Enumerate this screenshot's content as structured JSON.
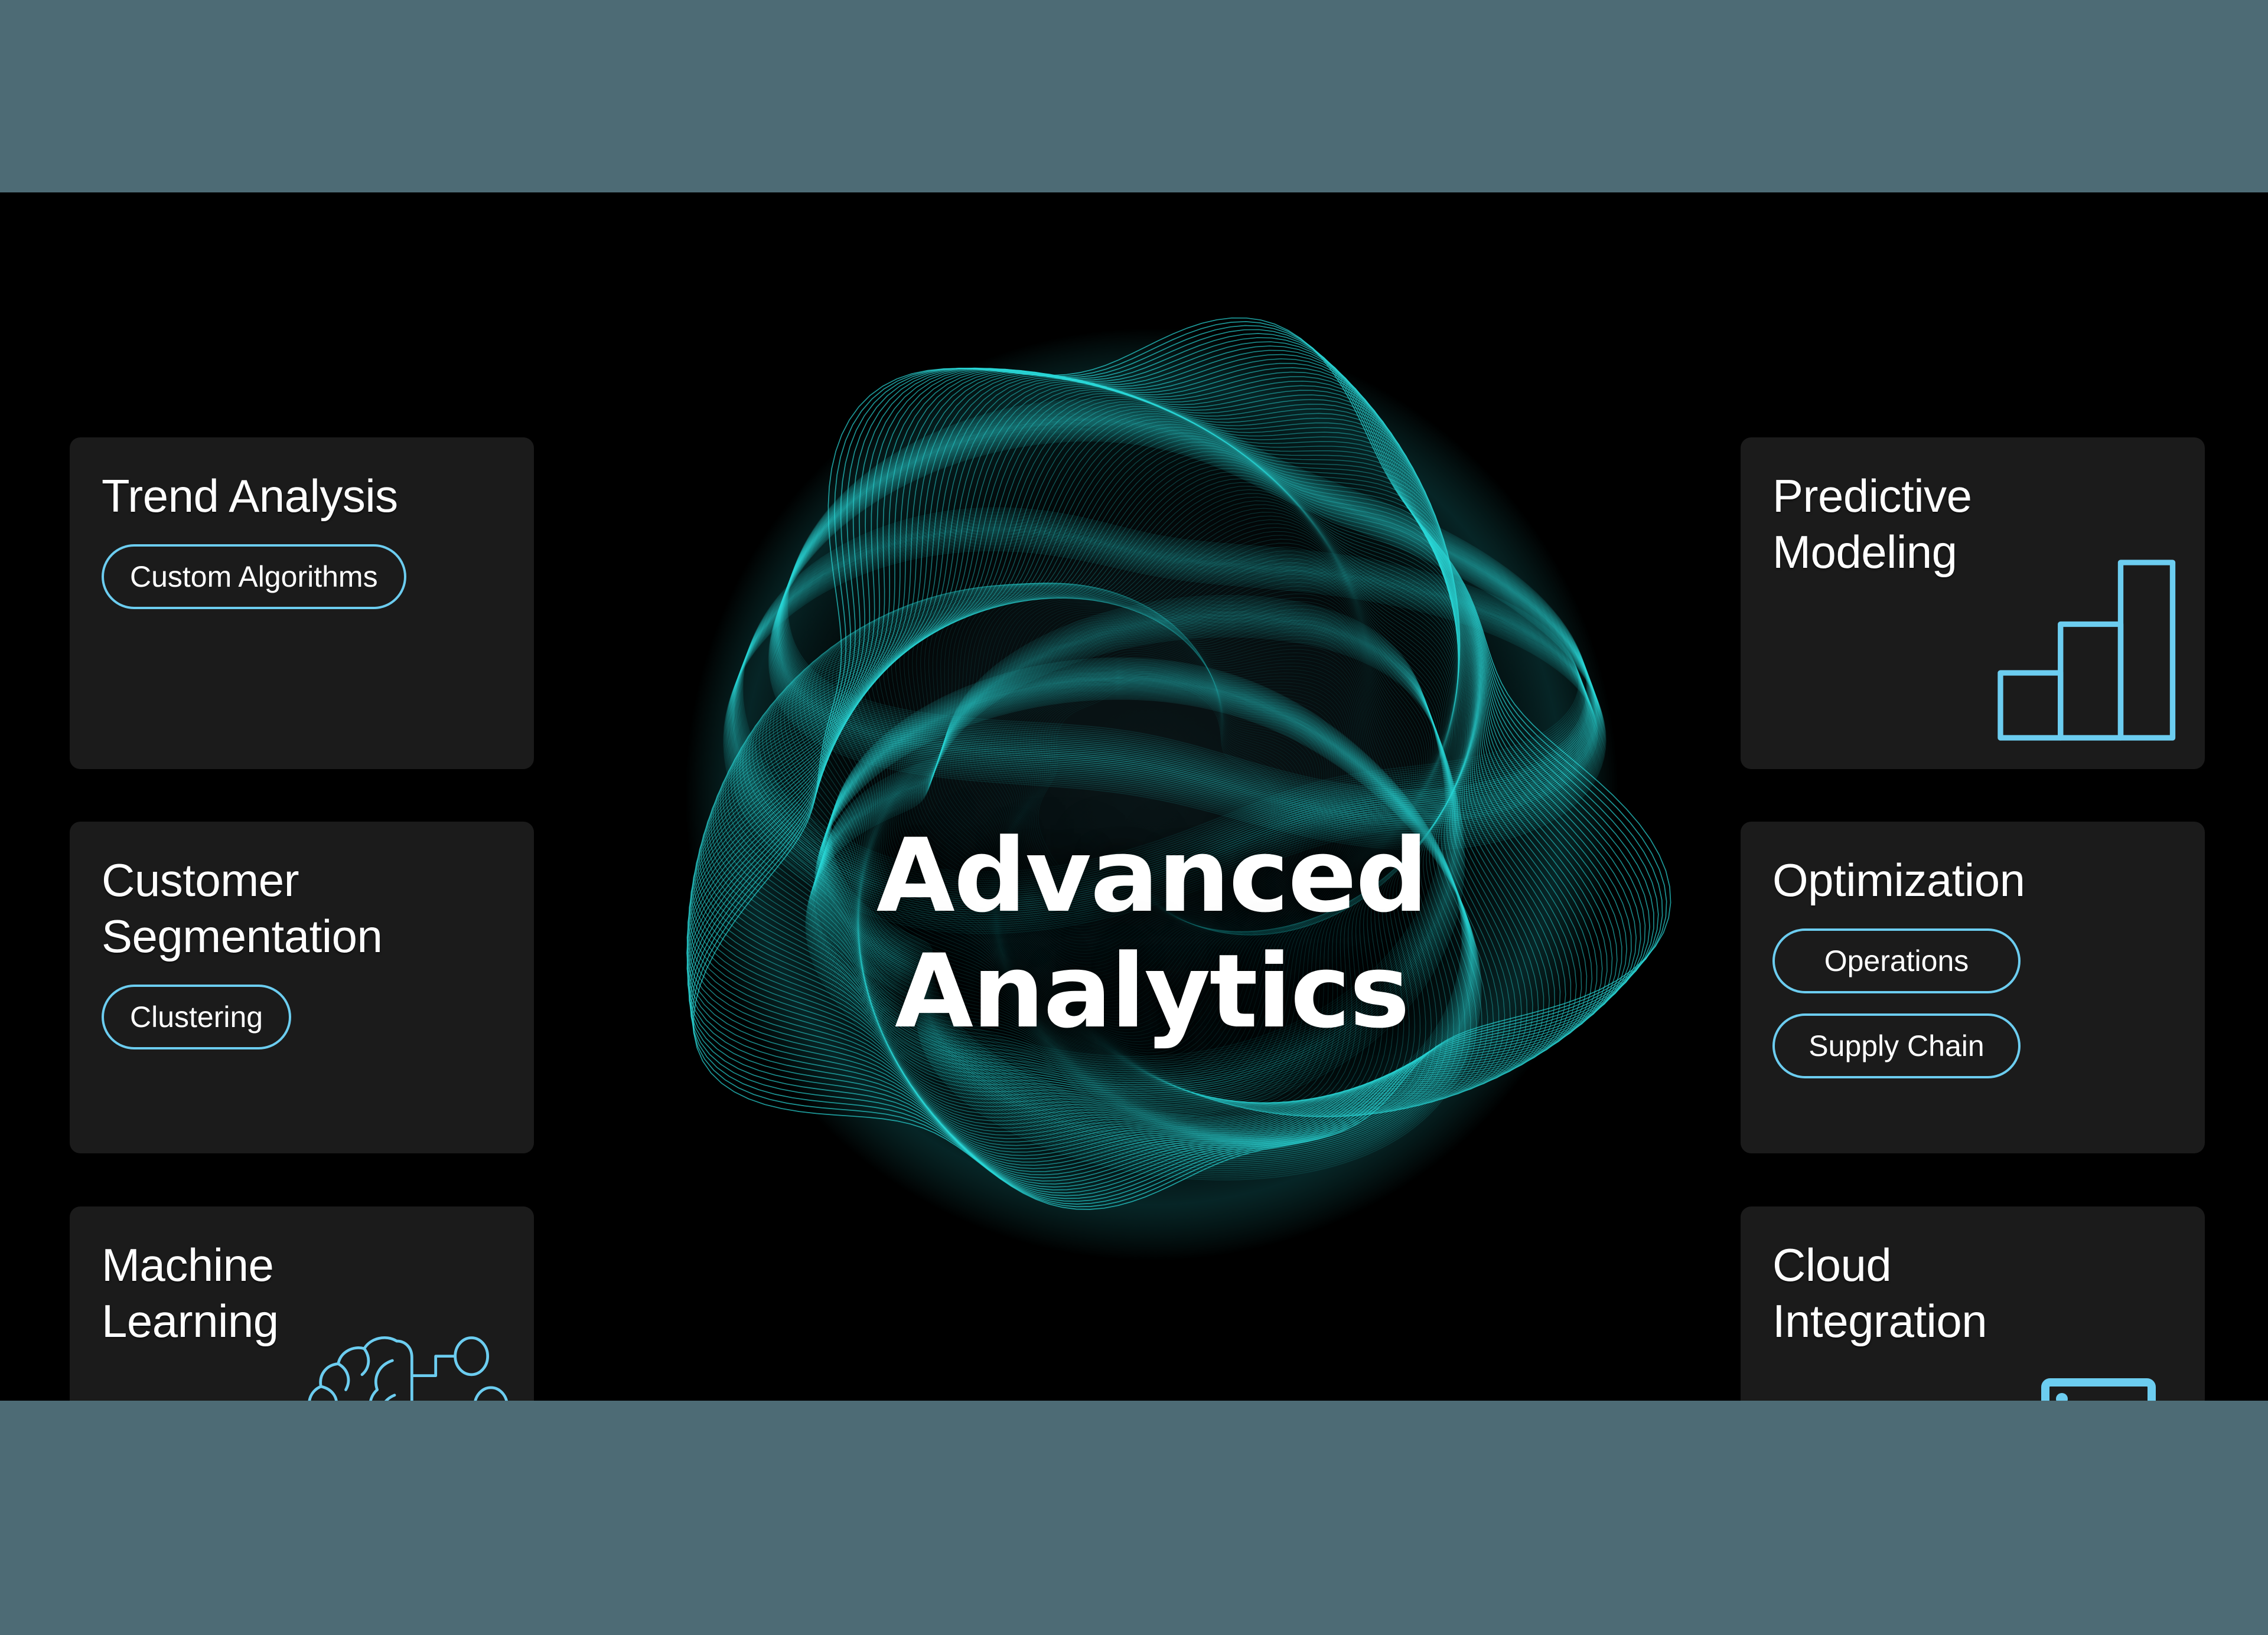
{
  "theme": {
    "stage_background": "#000000",
    "letterbox_color": "#4d6b75",
    "card_background": "#1b1b1b",
    "accent_cyan": "#6ccdf0",
    "orb_teal": "#2ad8d8",
    "text_color": "#ffffff"
  },
  "center": {
    "title_line1": "Advanced",
    "title_line2": "Analytics",
    "graphic_name": "wave-sphere-orb"
  },
  "cards": {
    "trend": {
      "title": "Trend Analysis",
      "pills": [
        "Custom Algorithms"
      ]
    },
    "customer": {
      "title": "Customer\nSegmentation",
      "pills": [
        "Clustering"
      ]
    },
    "machine_learning": {
      "title": "Machine\nLearning",
      "pills": [],
      "icon": "brain-circuit-icon"
    },
    "predictive": {
      "title": "Predictive\nModeling",
      "pills": [],
      "icon": "bar-chart-icon"
    },
    "optimization": {
      "title": "Optimization",
      "pills": [
        "Operations",
        "Supply Chain"
      ]
    },
    "cloud": {
      "title": "Cloud\nIntegration",
      "pills": [],
      "icon": "cloud-server-icon"
    }
  }
}
